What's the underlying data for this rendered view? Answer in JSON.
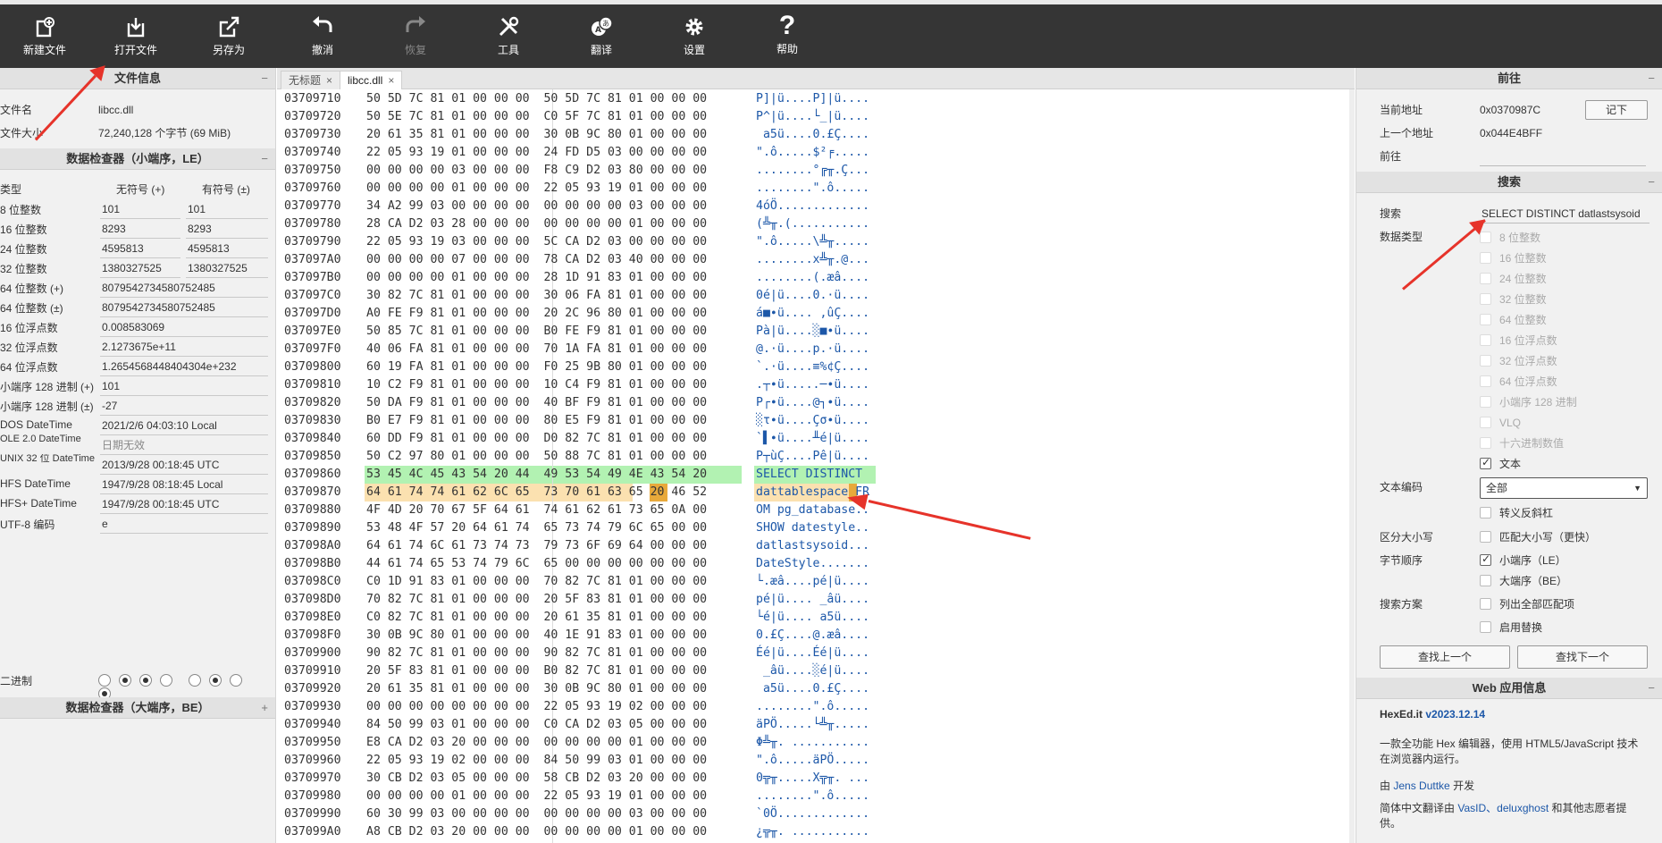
{
  "toolbar": {
    "items": [
      {
        "label": "新建文件",
        "icon": "new-file-icon",
        "disabled": false
      },
      {
        "label": "打开文件",
        "icon": "open-file-icon",
        "disabled": false
      },
      {
        "label": "另存为",
        "icon": "save-as-icon",
        "disabled": false
      },
      {
        "label": "撤消",
        "icon": "undo-icon",
        "disabled": false
      },
      {
        "label": "恢复",
        "icon": "redo-icon",
        "disabled": true
      },
      {
        "label": "工具",
        "icon": "tools-icon",
        "disabled": false
      },
      {
        "label": "翻译",
        "icon": "translate-icon",
        "disabled": false
      },
      {
        "label": "设置",
        "icon": "gear-icon",
        "disabled": false
      },
      {
        "label": "帮助",
        "icon": "help-icon",
        "disabled": false
      }
    ]
  },
  "file_info": {
    "title": "文件信息",
    "minimize": "−",
    "name_label": "文件名",
    "name_value": "libcc.dll",
    "size_label": "文件大小",
    "size_value": "72,240,128 个字节 (69 MiB)"
  },
  "inspector_le": {
    "title": "数据检查器（小端序，LE）",
    "minimize": "−",
    "col_type": "类型",
    "col_unsigned": "无符号 (+)",
    "col_signed": "有符号 (±)",
    "rows": [
      {
        "k": "8 位整数",
        "a": "101",
        "b": "101"
      },
      {
        "k": "16 位整数",
        "a": "8293",
        "b": "8293"
      },
      {
        "k": "24 位整数",
        "a": "4595813",
        "b": "4595813"
      },
      {
        "k": "32 位整数",
        "a": "1380327525",
        "b": "1380327525"
      }
    ],
    "wide_rows": [
      {
        "k": "64 位整数 (+)",
        "v": "8079542734580752485",
        "dim": false
      },
      {
        "k": "64 位整数 (±)",
        "v": "8079542734580752485",
        "dim": false
      },
      {
        "k": "16 位浮点数",
        "v": "0.008583069",
        "dim": false
      },
      {
        "k": "32 位浮点数",
        "v": "2.1273675e+11",
        "dim": false
      },
      {
        "k": "64 位浮点数",
        "v": "1.2654568448404304e+232",
        "dim": false
      },
      {
        "k": "小端序 128 进制 (+)",
        "v": "101",
        "dim": false
      },
      {
        "k": "小端序 128 进制 (±)",
        "v": "-27",
        "dim": false
      },
      {
        "k": "DOS DateTime",
        "v": "2021/2/6 04:03:10 Local",
        "dim": false
      },
      {
        "k": "OLE 2.0 DateTime",
        "v": "日期无效",
        "dim": true
      },
      {
        "k": "UNIX 32 位 DateTime",
        "v": "2013/9/28 00:18:45 UTC",
        "dim": false
      },
      {
        "k": "HFS DateTime",
        "v": "1947/9/28 08:18:45 Local",
        "dim": false
      },
      {
        "k": "HFS+ DateTime",
        "v": "1947/9/28 00:18:45 UTC",
        "dim": false
      },
      {
        "k": "UTF-8 编码",
        "v": "e",
        "dim": false
      }
    ],
    "binary_label": "二进制",
    "binary_bits": [
      0,
      1,
      1,
      0,
      0,
      1,
      0,
      1
    ]
  },
  "inspector_be": {
    "title": "数据检查器（大端序，BE）",
    "expand": "+"
  },
  "tabs": [
    {
      "label": "无标题",
      "close": "×",
      "active": false
    },
    {
      "label": "libcc.dll",
      "close": "×",
      "active": true
    }
  ],
  "hex_rows": [
    {
      "addr": "03709710",
      "hex": "50 5D 7C 81 01 00 00 00  50 5D 7C 81 01 00 00 00",
      "ascii": "P]|ü....P]|ü...."
    },
    {
      "addr": "03709720",
      "hex": "50 5E 7C 81 01 00 00 00  C0 5F 7C 81 01 00 00 00",
      "ascii": "P^|ü....└_|ü...."
    },
    {
      "addr": "03709730",
      "hex": "20 61 35 81 01 00 00 00  30 0B 9C 80 01 00 00 00",
      "ascii": " a5ü....0.£Ç...."
    },
    {
      "addr": "03709740",
      "hex": "22 05 93 19 01 00 00 00  24 FD D5 03 00 00 00 00",
      "ascii": "\".ô.....$²╒....."
    },
    {
      "addr": "03709750",
      "hex": "00 00 00 00 03 00 00 00  F8 C9 D2 03 80 00 00 00",
      "ascii": "........°╔╥.Ç..."
    },
    {
      "addr": "03709760",
      "hex": "00 00 00 00 01 00 00 00  22 05 93 19 01 00 00 00",
      "ascii": "........\".ô....."
    },
    {
      "addr": "03709770",
      "hex": "34 A2 99 03 00 00 00 00  00 00 00 00 03 00 00 00",
      "ascii": "4óÖ............."
    },
    {
      "addr": "03709780",
      "hex": "28 CA D2 03 28 00 00 00  00 00 00 00 01 00 00 00",
      "ascii": "(╩╥.(..........."
    },
    {
      "addr": "03709790",
      "hex": "22 05 93 19 03 00 00 00  5C CA D2 03 00 00 00 00",
      "ascii": "\".ô.....\\╩╥....."
    },
    {
      "addr": "037097A0",
      "hex": "00 00 00 00 07 00 00 00  78 CA D2 03 40 00 00 00",
      "ascii": "........x╩╥.@..."
    },
    {
      "addr": "037097B0",
      "hex": "00 00 00 00 01 00 00 00  28 1D 91 83 01 00 00 00",
      "ascii": "........(.æâ...."
    },
    {
      "addr": "037097C0",
      "hex": "30 82 7C 81 01 00 00 00  30 06 FA 81 01 00 00 00",
      "ascii": "0é|ü....0.·ü...."
    },
    {
      "addr": "037097D0",
      "hex": "A0 FE F9 81 01 00 00 00  20 2C 96 80 01 00 00 00",
      "ascii": "á■∙ü.... ,ûÇ...."
    },
    {
      "addr": "037097E0",
      "hex": "50 85 7C 81 01 00 00 00  B0 FE F9 81 01 00 00 00",
      "ascii": "Pà|ü....░■∙ü...."
    },
    {
      "addr": "037097F0",
      "hex": "40 06 FA 81 01 00 00 00  70 1A FA 81 01 00 00 00",
      "ascii": "@.·ü....p.·ü...."
    },
    {
      "addr": "03709800",
      "hex": "60 19 FA 81 01 00 00 00  F0 25 9B 80 01 00 00 00",
      "ascii": "`.·ü....≡%¢Ç...."
    },
    {
      "addr": "03709810",
      "hex": "10 C2 F9 81 01 00 00 00  10 C4 F9 81 01 00 00 00",
      "ascii": ".┬∙ü.....─∙ü...."
    },
    {
      "addr": "03709820",
      "hex": "50 DA F9 81 01 00 00 00  40 BF F9 81 01 00 00 00",
      "ascii": "P┌∙ü....@┐∙ü...."
    },
    {
      "addr": "03709830",
      "hex": "B0 E7 F9 81 01 00 00 00  80 E5 F9 81 01 00 00 00",
      "ascii": "░τ∙ü....Çσ∙ü...."
    },
    {
      "addr": "03709840",
      "hex": "60 DD F9 81 01 00 00 00  D0 82 7C 81 01 00 00 00",
      "ascii": "`▌∙ü....╨é|ü...."
    },
    {
      "addr": "03709850",
      "hex": "50 C2 97 80 01 00 00 00  50 88 7C 81 01 00 00 00",
      "ascii": "P┬ùÇ....Pê|ü...."
    },
    {
      "addr": "03709860",
      "hex": "53 45 4C 45 43 54 20 44  49 53 54 49 4E 43 54 20",
      "ascii": "SELECT DISTINCT "
    },
    {
      "addr": "03709870",
      "hex": "64 61 74 74 61 62 6C 65  73 70 61 63 65 20 46 52",
      "ascii": "dattablespace FR"
    },
    {
      "addr": "03709880",
      "hex": "4F 4D 20 70 67 5F 64 61  74 61 62 61 73 65 0A 00",
      "ascii": "OM pg_database.."
    },
    {
      "addr": "03709890",
      "hex": "53 48 4F 57 20 64 61 74  65 73 74 79 6C 65 00 00",
      "ascii": "SHOW datestyle.."
    },
    {
      "addr": "037098A0",
      "hex": "64 61 74 6C 61 73 74 73  79 73 6F 69 64 00 00 00",
      "ascii": "datlastsysoid..."
    },
    {
      "addr": "037098B0",
      "hex": "44 61 74 65 53 74 79 6C  65 00 00 00 00 00 00 00",
      "ascii": "DateStyle......."
    },
    {
      "addr": "037098C0",
      "hex": "C0 1D 91 83 01 00 00 00  70 82 7C 81 01 00 00 00",
      "ascii": "└.æâ....pé|ü...."
    },
    {
      "addr": "037098D0",
      "hex": "70 82 7C 81 01 00 00 00  20 5F 83 81 01 00 00 00",
      "ascii": "pé|ü.... _âü...."
    },
    {
      "addr": "037098E0",
      "hex": "C0 82 7C 81 01 00 00 00  20 61 35 81 01 00 00 00",
      "ascii": "└é|ü.... a5ü...."
    },
    {
      "addr": "037098F0",
      "hex": "30 0B 9C 80 01 00 00 00  40 1E 91 83 01 00 00 00",
      "ascii": "0.£Ç....@.æâ...."
    },
    {
      "addr": "03709900",
      "hex": "90 82 7C 81 01 00 00 00  90 82 7C 81 01 00 00 00",
      "ascii": "Éé|ü....Éé|ü...."
    },
    {
      "addr": "03709910",
      "hex": "20 5F 83 81 01 00 00 00  B0 82 7C 81 01 00 00 00",
      "ascii": " _âü....░é|ü...."
    },
    {
      "addr": "03709920",
      "hex": "20 61 35 81 01 00 00 00  30 0B 9C 80 01 00 00 00",
      "ascii": " a5ü....0.£Ç...."
    },
    {
      "addr": "03709930",
      "hex": "00 00 00 00 00 00 00 00  22 05 93 19 02 00 00 00",
      "ascii": "........\".ô....."
    },
    {
      "addr": "03709940",
      "hex": "84 50 99 03 01 00 00 00  C0 CA D2 03 05 00 00 00",
      "ascii": "äPÖ.....└╩╥....."
    },
    {
      "addr": "03709950",
      "hex": "E8 CA D2 03 20 00 00 00  00 00 00 00 01 00 00 00",
      "ascii": "Φ╩╥. ..........."
    },
    {
      "addr": "03709960",
      "hex": "22 05 93 19 02 00 00 00  84 50 99 03 01 00 00 00",
      "ascii": "\".ô.....äPÖ....."
    },
    {
      "addr": "03709970",
      "hex": "30 CB D2 03 05 00 00 00  58 CB D2 03 20 00 00 00",
      "ascii": "0╦╥.....X╦╥. ..."
    },
    {
      "addr": "03709980",
      "hex": "00 00 00 00 01 00 00 00  22 05 93 19 01 00 00 00",
      "ascii": "........\".ô....."
    },
    {
      "addr": "03709990",
      "hex": "60 30 99 03 00 00 00 00  00 00 00 00 03 00 00 00",
      "ascii": "`0Ö............."
    },
    {
      "addr": "037099A0",
      "hex": "A8 CB D2 03 20 00 00 00  00 00 00 00 01 00 00 00",
      "ascii": "¿╦╥. ..........."
    }
  ],
  "goto": {
    "title": "前往",
    "minimize": "−",
    "current_label": "当前地址",
    "current_value": "0x0370987C",
    "mark_button": "记下",
    "prev_label": "上一个地址",
    "prev_value": "0x044E4BFF",
    "goto_label": "前往",
    "goto_value": ""
  },
  "search": {
    "title": "搜索",
    "minimize": "−",
    "search_label": "搜索",
    "search_value": "SELECT DISTINCT datlastsysoid",
    "type_label": "数据类型",
    "types": [
      {
        "label": "8 位整数",
        "checked": false,
        "dim": true
      },
      {
        "label": "16 位整数",
        "checked": false,
        "dim": true
      },
      {
        "label": "24 位整数",
        "checked": false,
        "dim": true
      },
      {
        "label": "32 位整数",
        "checked": false,
        "dim": true
      },
      {
        "label": "64 位整数",
        "checked": false,
        "dim": true
      },
      {
        "label": "16 位浮点数",
        "checked": false,
        "dim": true
      },
      {
        "label": "32 位浮点数",
        "checked": false,
        "dim": true
      },
      {
        "label": "64 位浮点数",
        "checked": false,
        "dim": true
      },
      {
        "label": "小端序 128 进制",
        "checked": false,
        "dim": true
      },
      {
        "label": "VLQ",
        "checked": false,
        "dim": true
      },
      {
        "label": "十六进制数值",
        "checked": false,
        "dim": true
      },
      {
        "label": "文本",
        "checked": true,
        "dim": false
      }
    ],
    "encoding_label": "文本编码",
    "encoding_value": "全部",
    "escape_label": "转义反斜杠",
    "case_label": "区分大小写",
    "case_option": "匹配大小写（更快）",
    "order_label": "字节顺序",
    "order_le": "小端序（LE）",
    "order_be": "大端序（BE）",
    "scheme_label": "搜索方案",
    "list_all": "列出全部匹配项",
    "replace": "启用替换",
    "prev_button": "查找上一个",
    "next_button": "查找下一个"
  },
  "webapp": {
    "title": "Web 应用信息",
    "minimize": "−",
    "name": "HexEd.it",
    "version": "v2023.12.14",
    "desc": "一款全功能 Hex 编辑器，使用 HTML5/JavaScript 技术在浏览器内运行。",
    "by_prefix": "由",
    "author": "Jens Duttke",
    "by_suffix": "开发",
    "trans_prefix": "简体中文翻译由",
    "translators": "VasID、deluxghost",
    "trans_suffix": "和其他志愿者提供。"
  }
}
